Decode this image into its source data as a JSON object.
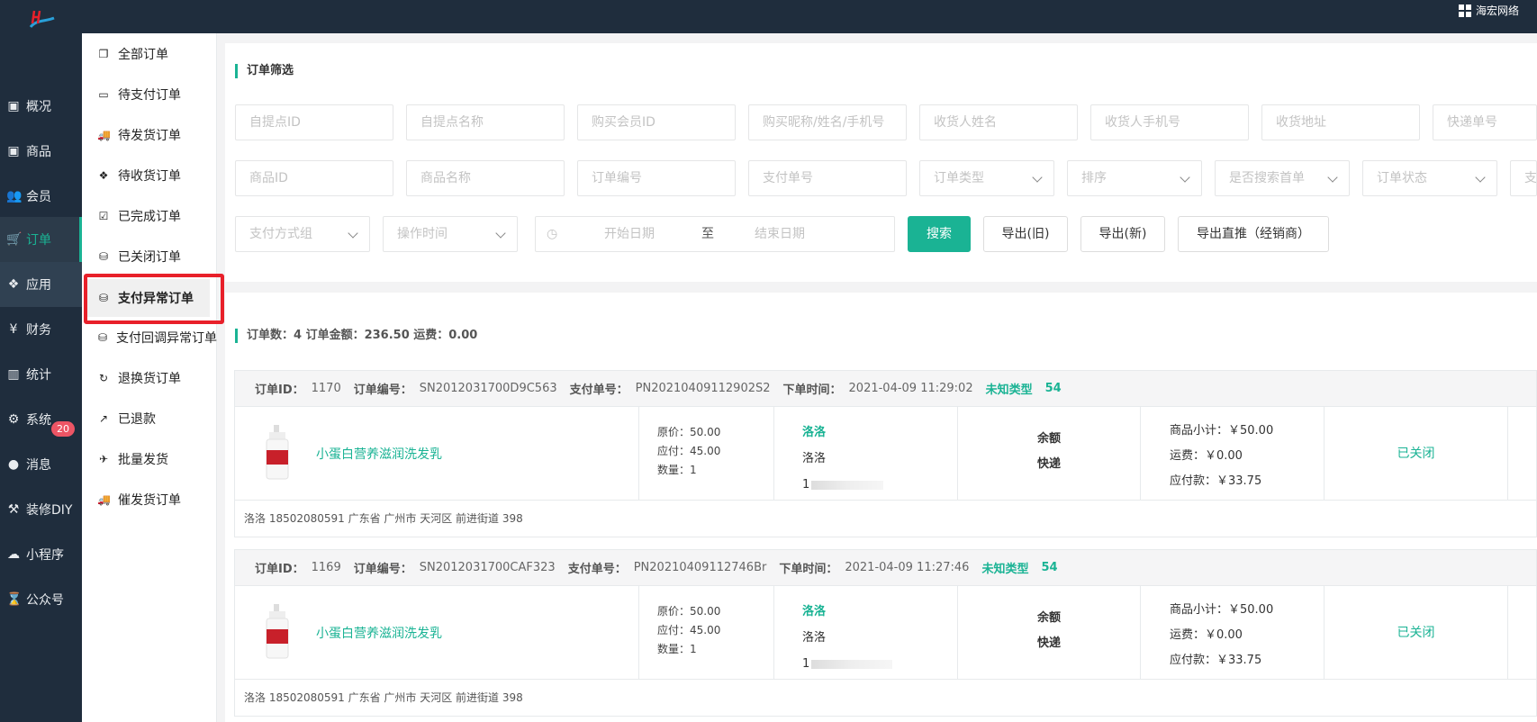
{
  "brand": {
    "name": "海宏网络"
  },
  "left_nav": [
    {
      "label": "概况",
      "icon": "archive-icon"
    },
    {
      "label": "商品",
      "icon": "archive-icon"
    },
    {
      "label": "会员",
      "icon": "users-icon"
    },
    {
      "label": "订单",
      "icon": "cart-icon"
    },
    {
      "label": "应用",
      "icon": "cubes-icon"
    },
    {
      "label": "财务",
      "icon": "yen-icon"
    },
    {
      "label": "统计",
      "icon": "bar-chart-icon"
    },
    {
      "label": "系统",
      "icon": "cogs-icon"
    },
    {
      "label": "消息",
      "icon": "comment-icon"
    },
    {
      "label": "装修DIY",
      "icon": "gavel-icon"
    },
    {
      "label": "小程序",
      "icon": "wechat-icon"
    },
    {
      "label": "公众号",
      "icon": "hourglass-icon"
    }
  ],
  "message_badge": "20",
  "sub_nav": [
    {
      "label": "全部订单",
      "icon": "copy-icon"
    },
    {
      "label": "待支付订单",
      "icon": "credit-card-icon"
    },
    {
      "label": "待发货订单",
      "icon": "truck-icon"
    },
    {
      "label": "待收货订单",
      "icon": "dropbox-icon"
    },
    {
      "label": "已完成订单",
      "icon": "check-square-icon"
    },
    {
      "label": "已关闭订单",
      "icon": "database-icon"
    },
    {
      "label": "支付异常订单",
      "icon": "database-icon"
    },
    {
      "label": "支付回调异常订单",
      "icon": "database-icon"
    },
    {
      "label": "退换货订单",
      "icon": "refresh-icon"
    },
    {
      "label": "已退款",
      "icon": "share-square-icon"
    },
    {
      "label": "批量发货",
      "icon": "paper-plane-icon"
    },
    {
      "label": "催发货订单",
      "icon": "truck-icon"
    }
  ],
  "filter": {
    "title": "订单筛选",
    "row1": [
      "自提点ID",
      "自提点名称",
      "购买会员ID",
      "购买昵称/姓名/手机号",
      "收货人姓名",
      "收货人手机号",
      "收货地址",
      "快递单号"
    ],
    "row2_inputs": [
      "商品ID",
      "商品名称",
      "订单编号",
      "支付单号"
    ],
    "row2_selects": [
      "订单类型",
      "排序",
      "是否搜索首单",
      "订单状态",
      "支"
    ],
    "row3_selects": [
      "支付方式组",
      "操作时间"
    ],
    "date_start": "开始日期",
    "date_sep": "至",
    "date_end": "结束日期",
    "search_btn": "搜索",
    "export_old": "导出(旧)",
    "export_new": "导出(新)",
    "export_direct": "导出直推（经销商）"
  },
  "summary": {
    "text": "订单数：4   订单金额：236.50   运费：0.00"
  },
  "orders": [
    {
      "id_label": "订单ID：",
      "id": "1170",
      "no_label": "订单编号：",
      "no": "SN2012031700D9C563",
      "pay_label": "支付单号：",
      "pay": "PN20210409112902S2",
      "time_label": "下单时间：",
      "time": "2021-04-09 11:29:02",
      "type": "未知类型",
      "type_num": "54",
      "product": "小蛋白营养滋润洗发乳",
      "price_orig": "原价：50.00",
      "price_pay": "应付：45.00",
      "qty": "数量：1",
      "buyer_link": "洛洛",
      "buyer_name": "洛洛",
      "buyer_phone": "1",
      "pay_method": "余额",
      "ship_method": "快递",
      "subtotal": "商品小计：￥50.00",
      "freight": "运费：￥0.00",
      "payable": "应付款：￥33.75",
      "status": "已关闭",
      "address": "洛洛   18502080591   广东省 广州市 天河区 前进街道 398"
    },
    {
      "id_label": "订单ID：",
      "id": "1169",
      "no_label": "订单编号：",
      "no": "SN2012031700CAF323",
      "pay_label": "支付单号：",
      "pay": "PN20210409112746Br",
      "time_label": "下单时间：",
      "time": "2021-04-09 11:27:46",
      "type": "未知类型",
      "type_num": "54",
      "product": "小蛋白营养滋润洗发乳",
      "price_orig": "原价：50.00",
      "price_pay": "应付：45.00",
      "qty": "数量：1",
      "buyer_link": "洛洛",
      "buyer_name": "洛洛",
      "buyer_phone": "1",
      "pay_method": "余额",
      "ship_method": "快递",
      "subtotal": "商品小计：￥50.00",
      "freight": "运费：￥0.00",
      "payable": "应付款：￥33.75",
      "status": "已关闭",
      "address": "洛洛   18502080591   广东省 广州市 天河区 前进街道 398"
    }
  ]
}
